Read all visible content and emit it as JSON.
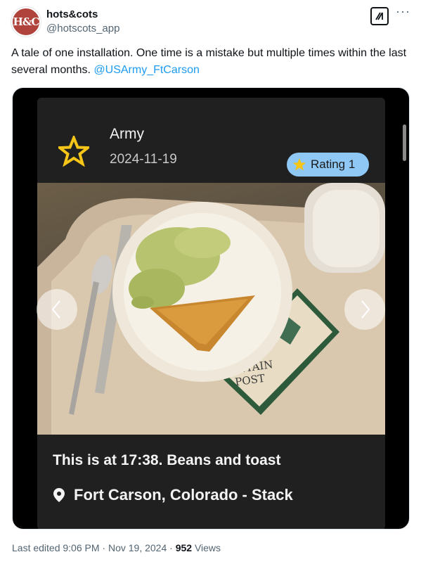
{
  "author": {
    "avatar_text": "H&C",
    "display_name": "hots&cots",
    "handle": "@hotscots_app"
  },
  "tweet": {
    "text": "A tale of one installation. One time is a mistake but multiple times within the last several months. ",
    "mention": "@USArmy_FtCarson"
  },
  "card": {
    "branch": "Army",
    "date": "2024-11-19",
    "rating_label": "Rating 1",
    "caption": "This is at 17:38. Beans and toast",
    "location": "Fort Carson, Colorado - Stack",
    "photo_placemat_text": "NTAIN POST"
  },
  "meta": {
    "edited": "Last edited 9:06 PM · Nov 19, 2024 · ",
    "views_count": "952",
    "views_label": " Views"
  },
  "icons": {
    "star": "star-icon",
    "location": "location-pin-icon",
    "prev": "chevron-left-icon",
    "next": "chevron-right-icon",
    "grok": "grok-icon",
    "more": "more-icon"
  },
  "colors": {
    "star": "#f5c518",
    "rating_badge": "#8fc7f5",
    "link": "#1d9bf0"
  }
}
